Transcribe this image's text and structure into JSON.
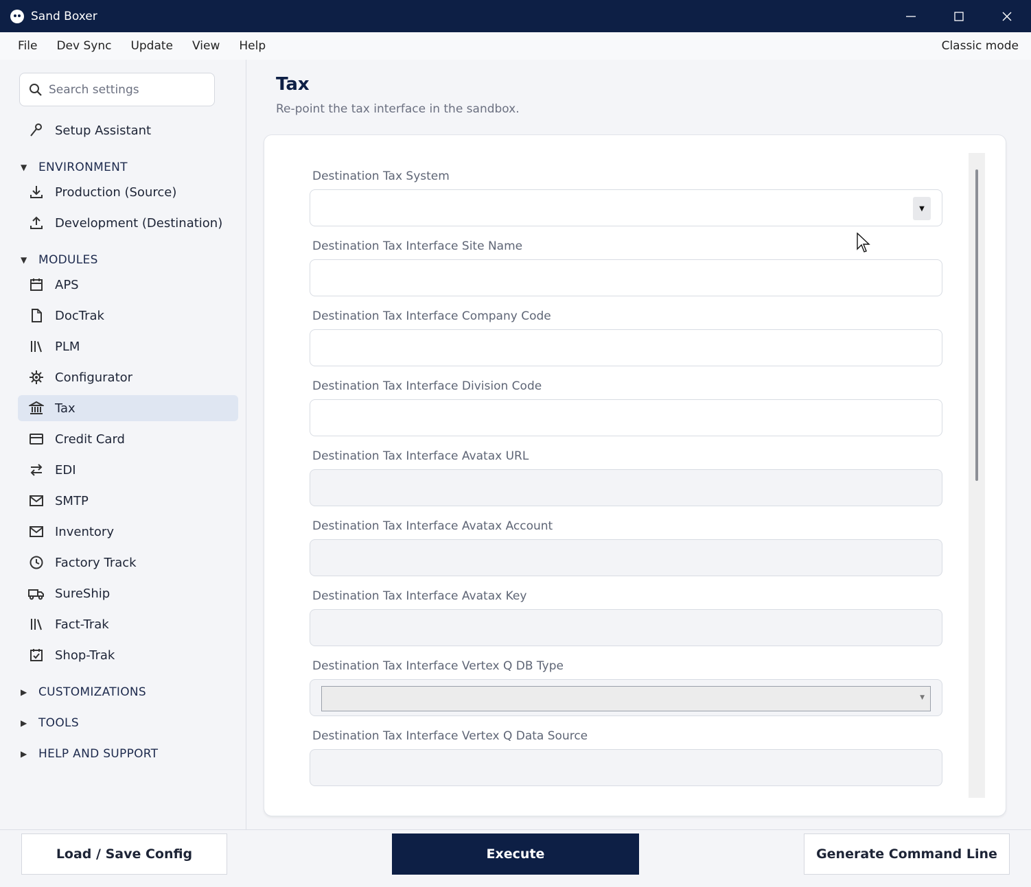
{
  "window": {
    "title": "Sand Boxer",
    "minimize": "—",
    "maximize": "☐",
    "close": "✕"
  },
  "menu": {
    "items": [
      "File",
      "Dev Sync",
      "Update",
      "View",
      "Help"
    ],
    "classic_mode": "Classic mode"
  },
  "sidebar": {
    "search_placeholder": "Search settings",
    "setup_assistant": "Setup Assistant",
    "sections": {
      "environment": "ENVIRONMENT",
      "modules": "MODULES",
      "customizations": "CUSTOMIZATIONS",
      "tools": "TOOLS",
      "help_support": "HELP AND SUPPORT"
    },
    "environment_items": [
      "Production (Source)",
      "Development (Destination)"
    ],
    "module_items": [
      "APS",
      "DocTrak",
      "PLM",
      "Configurator",
      "Tax",
      "Credit Card",
      "EDI",
      "SMTP",
      "Inventory",
      "Factory Track",
      "SureShip",
      "Fact-Trak",
      "Shop-Trak"
    ],
    "active_item": "Tax"
  },
  "main": {
    "title": "Tax",
    "subtitle": "Re-point the tax interface in the sandbox.",
    "fields": [
      {
        "label": "Destination Tax System",
        "value": ""
      },
      {
        "label": "Destination Tax Interface Site Name",
        "value": ""
      },
      {
        "label": "Destination Tax Interface Company Code",
        "value": ""
      },
      {
        "label": "Destination Tax Interface Division Code",
        "value": ""
      },
      {
        "label": "Destination Tax Interface Avatax URL",
        "value": ""
      },
      {
        "label": "Destination Tax Interface Avatax Account",
        "value": ""
      },
      {
        "label": "Destination Tax Interface Avatax Key",
        "value": ""
      },
      {
        "label": "Destination Tax Interface Vertex Q DB Type",
        "value": ""
      },
      {
        "label": "Destination Tax Interface Vertex Q Data Source",
        "value": ""
      }
    ]
  },
  "footer": {
    "load_save": "Load / Save Config",
    "execute": "Execute",
    "generate": "Generate Command Line"
  },
  "colors": {
    "navy": "#0d1f45",
    "active_bg": "#dfe6f2",
    "background": "#f4f5f8"
  }
}
